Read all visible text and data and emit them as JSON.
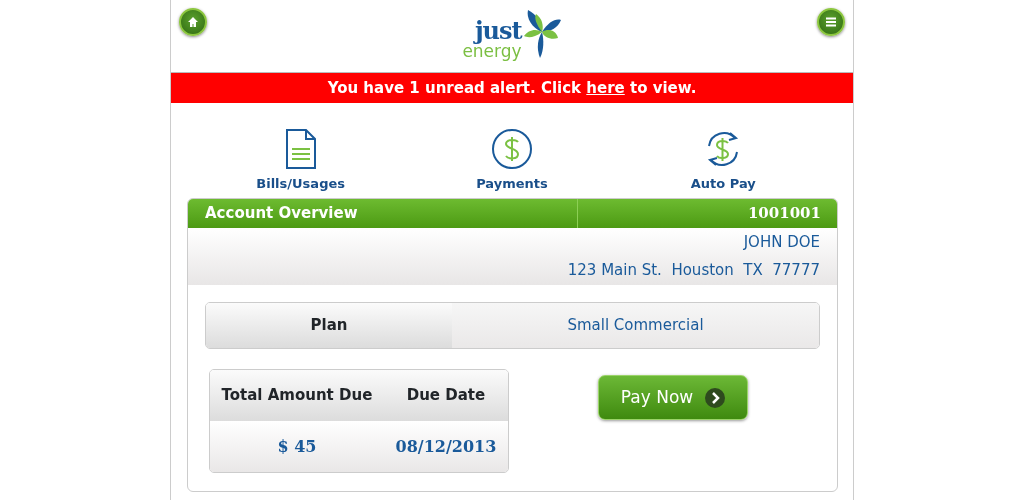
{
  "header": {
    "logo_top": "just",
    "logo_bottom": "energy"
  },
  "alert": {
    "before": "You have 1 unread alert. Click ",
    "link": "here",
    "after": " to view."
  },
  "quick_links": [
    {
      "kind": "bill",
      "label": "Bills/Usages"
    },
    {
      "kind": "dollar",
      "label": "Payments"
    },
    {
      "kind": "autopay",
      "label": "Auto Pay"
    }
  ],
  "account": {
    "title": "Account Overview",
    "number": "1001001",
    "name": "JOHN DOE",
    "address": "123 Main St.  Houston  TX  77777"
  },
  "plan": {
    "label": "Plan",
    "value": "Small Commercial"
  },
  "billing": {
    "columns": [
      "Total Amount Due",
      "Due Date"
    ],
    "values": [
      "$ 45",
      "08/12/2013"
    ]
  },
  "pay_button": "Pay Now"
}
